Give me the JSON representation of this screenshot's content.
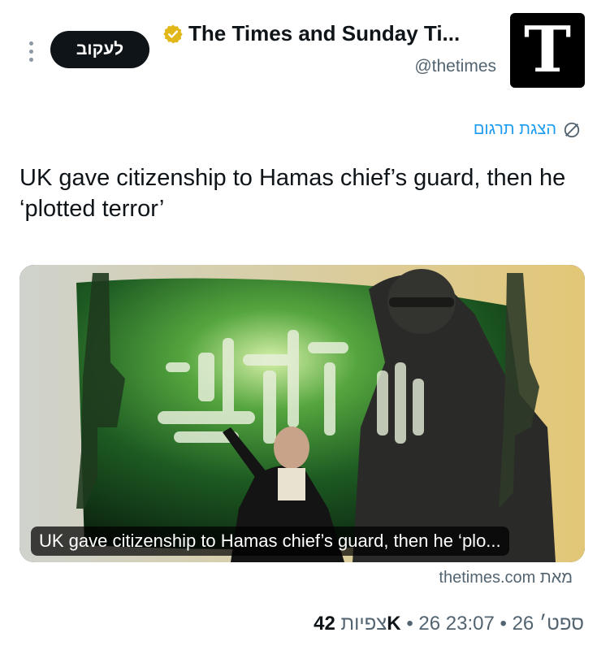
{
  "header": {
    "follow_label": "לעקוב",
    "account_name": "The Times and Sunday Ti...",
    "handle": "@thetimes",
    "avatar_letter": "T"
  },
  "translate_label": "הצגת תרגום",
  "tweet_text": "UK gave citizenship to Hamas chief’s guard, then he ‘plotted terror’",
  "card": {
    "caption": "UK gave citizenship to Hamas chief’s guard, then he ‘plo..."
  },
  "source_link": "thetimes.com מאת",
  "meta": {
    "time": "23:07",
    "date": "26 ספט׳ 26",
    "views_count": "42K",
    "views_label": "צפיות",
    "separator": "•"
  },
  "colors": {
    "accent": "#1d9bf0",
    "verified_gold": "#e2b719",
    "text_secondary": "#536471"
  }
}
